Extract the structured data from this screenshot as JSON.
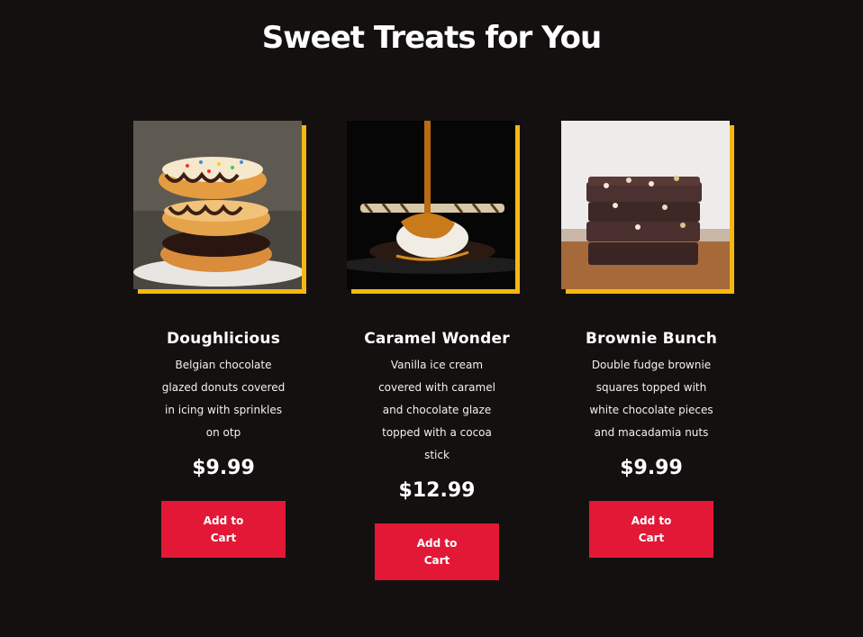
{
  "page": {
    "title": "Sweet Treats for You"
  },
  "products": [
    {
      "name": "Doughlicious",
      "description": "Belgian chocolate glazed donuts covered in icing with sprinkles on otp",
      "price": "$9.99",
      "button_label": "Add to Cart",
      "image_icon": "donut-stack-photo"
    },
    {
      "name": "Caramel Wonder",
      "description": "Vanilla ice cream covered with caramel and chocolate glaze topped with a cocoa stick",
      "price": "$12.99",
      "button_label": "Add to Cart",
      "image_icon": "ice-cream-caramel-photo"
    },
    {
      "name": "Brownie Bunch",
      "description": "Double fudge brownie squares topped with white chocolate pieces and macadamia nuts",
      "price": "$9.99",
      "button_label": "Add to Cart",
      "image_icon": "brownie-stack-photo"
    }
  ],
  "colors": {
    "background": "#141010",
    "accent_frame": "#f5b80f",
    "button": "#e21836",
    "text": "#ffffff"
  }
}
